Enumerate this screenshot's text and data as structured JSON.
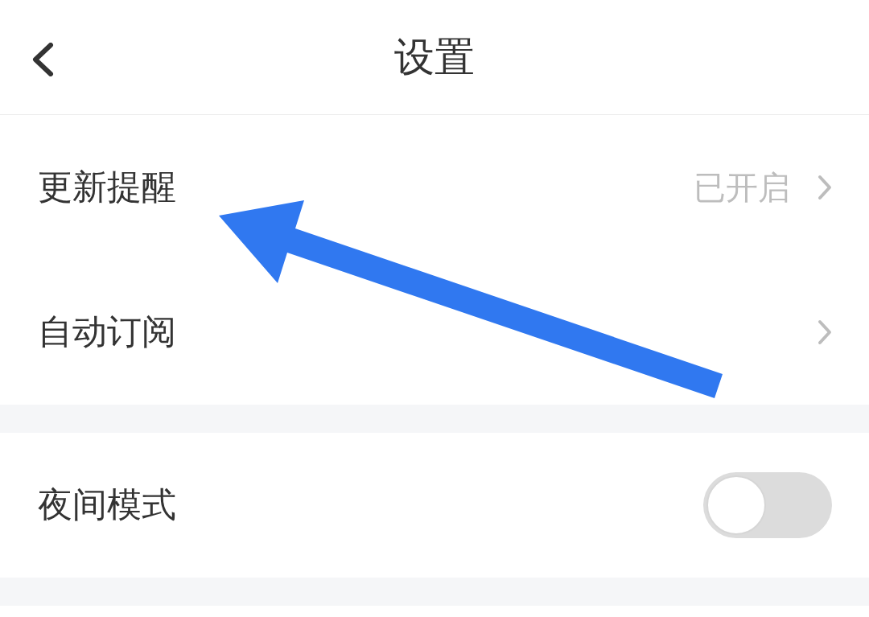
{
  "header": {
    "title": "设置"
  },
  "groups": [
    {
      "items": [
        {
          "kind": "value",
          "label": "更新提醒",
          "value": "已开启"
        },
        {
          "kind": "link",
          "label": "自动订阅"
        }
      ]
    },
    {
      "items": [
        {
          "kind": "toggle",
          "label": "夜间模式",
          "on": false
        }
      ]
    }
  ],
  "annotations": [
    {
      "kind": "arrow"
    }
  ]
}
